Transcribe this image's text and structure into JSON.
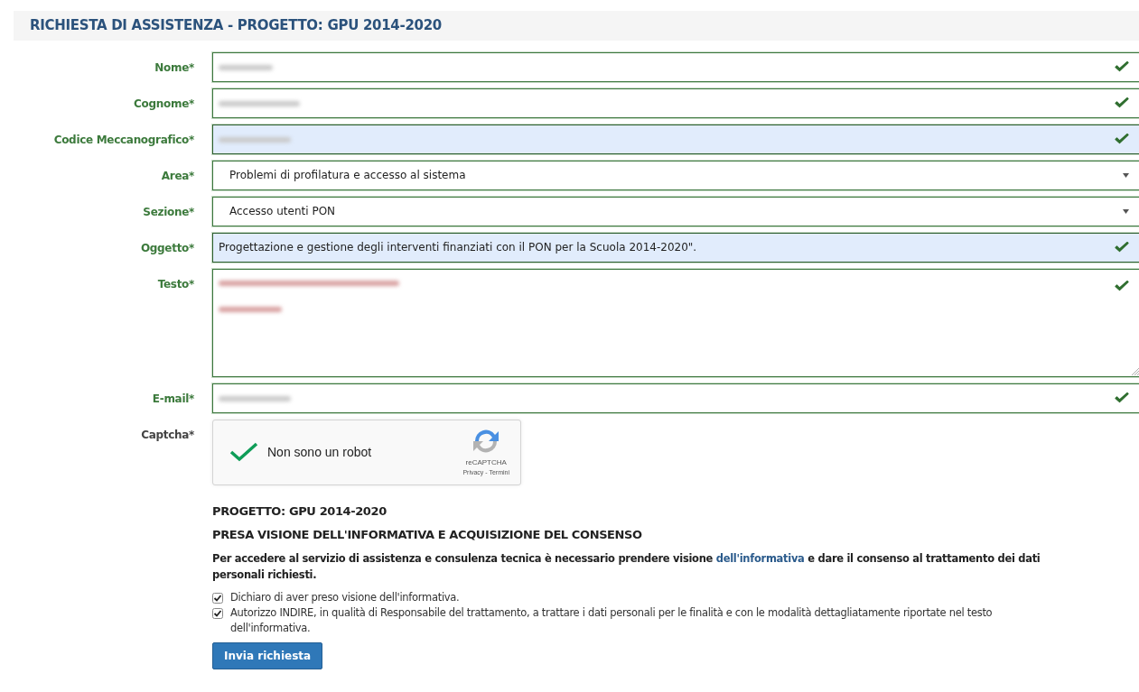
{
  "title": "RICHIESTA DI ASSISTENZA - PROGETTO: GPU 2014-2020",
  "fields": [
    {
      "label": "Nome*",
      "kind": "text",
      "valid": true,
      "autofilled": false,
      "redacted": true
    },
    {
      "label": "Cognome*",
      "kind": "text",
      "valid": true,
      "autofilled": false,
      "redacted": true
    },
    {
      "label": "Codice Meccanografico*",
      "kind": "text",
      "valid": true,
      "autofilled": true,
      "redacted": true
    },
    {
      "label": "Area*",
      "kind": "select",
      "value": "Problemi di profilatura e accesso al sistema"
    },
    {
      "label": "Sezione*",
      "kind": "select",
      "value": "Accesso utenti PON"
    },
    {
      "label": "Oggetto*",
      "kind": "text",
      "valid": true,
      "autofilled": true,
      "value": "Progettazione e gestione degli interventi finanziati con il PON per la Scuola 2014-2020\"."
    },
    {
      "label": "Testo*",
      "kind": "textarea",
      "valid": true,
      "autofilled": false,
      "redacted": true
    },
    {
      "label": "E-mail*",
      "kind": "text",
      "valid": true,
      "autofilled": false,
      "redacted": true
    }
  ],
  "captcha": {
    "label": "Captcha*",
    "checked": true,
    "text": "Non sono un robot",
    "brand": "reCAPTCHA",
    "links": "Privacy - Termini"
  },
  "project_heading": "PROGETTO: GPU 2014-2020",
  "consent_heading": "PRESA VISIONE DELL'INFORMATIVA E ACQUISIZIONE DEL CONSENSO",
  "intro": {
    "before": "Per accedere al servizio di assistenza e consulenza tecnica è necessario prendere visione ",
    "link": "dell'informativa",
    "after": " e dare il consenso al trattamento dei dati personali richiesti."
  },
  "consents": [
    {
      "label": "Dichiaro di aver preso visione dell'informativa.",
      "checked": true
    },
    {
      "label": "Autorizzo INDIRE, in qualità di Responsabile del trattamento, a trattare i dati personali per le finalità e con le modalità dettagliatamente riportate nel testo dell'informativa.",
      "checked": true
    }
  ],
  "submit": "Invia richiesta"
}
